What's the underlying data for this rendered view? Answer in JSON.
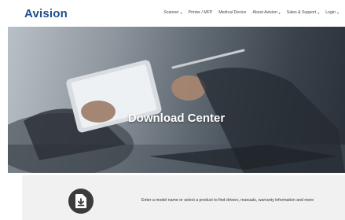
{
  "header": {
    "logo_text": "Avision",
    "nav": [
      {
        "label": "Scanner",
        "has_dropdown": true
      },
      {
        "label": "Printer / MFP",
        "has_dropdown": false
      },
      {
        "label": "Medical Device",
        "has_dropdown": false
      },
      {
        "label": "About Avision",
        "has_dropdown": true
      },
      {
        "label": "Sales & Support",
        "has_dropdown": true
      },
      {
        "label": "Login",
        "has_dropdown": true
      }
    ]
  },
  "hero": {
    "title": "Download Center"
  },
  "download_panel": {
    "icon": "download-file-icon",
    "prompt": "Enter a model name or select a product to find drivers, manuals, warranty information and more"
  },
  "colors": {
    "logo": "#1f4e8c",
    "panel_bg": "#f1f1f1",
    "icon_bg": "#3b3b3b"
  }
}
